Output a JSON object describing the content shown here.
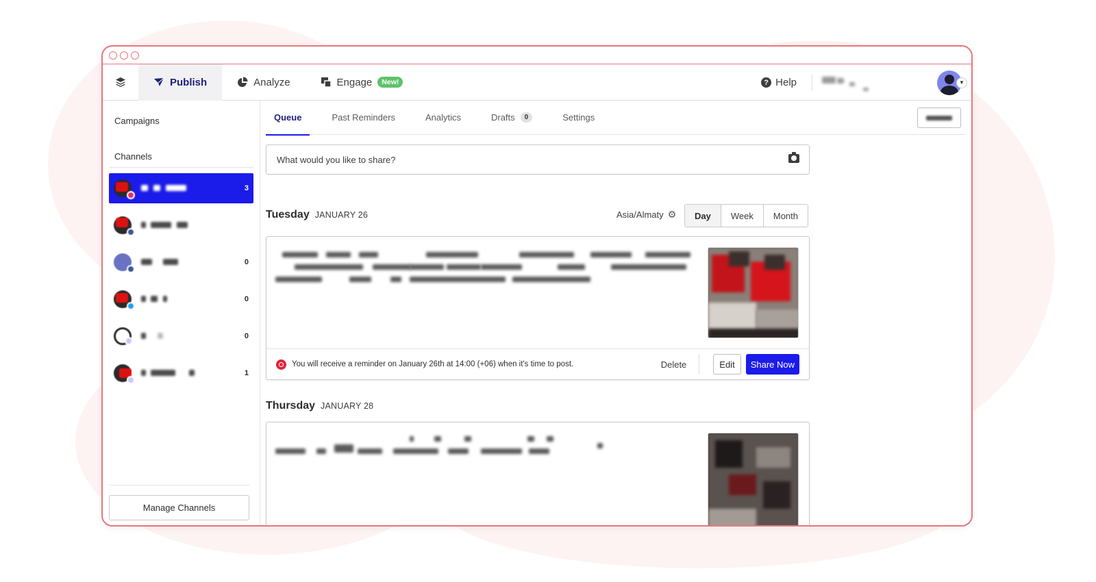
{
  "nav": {
    "publish": "Publish",
    "analyze": "Analyze",
    "engage": "Engage",
    "new_badge": "New!",
    "help": "Help"
  },
  "sidebar": {
    "campaigns": "Campaigns",
    "channels_heading": "Channels",
    "channels": [
      {
        "count": "3",
        "active": true,
        "network_color": "#e1306c"
      },
      {
        "count": "",
        "active": false,
        "network_color": "#3b5998"
      },
      {
        "count": "0",
        "active": false,
        "network_color": "#3b5998"
      },
      {
        "count": "0",
        "active": false,
        "network_color": "#1da1f2"
      },
      {
        "count": "0",
        "active": false,
        "network_color": "#1b1bea"
      },
      {
        "count": "1",
        "active": false,
        "network_color": "#c9c9ff"
      }
    ],
    "manage_channels": "Manage Channels"
  },
  "tabs": {
    "queue": "Queue",
    "past_reminders": "Past Reminders",
    "analytics": "Analytics",
    "drafts": "Drafts",
    "drafts_count": "0",
    "settings": "Settings"
  },
  "composer": {
    "placeholder": "What would you like to share?"
  },
  "timezone": "Asia/Almaty",
  "view_toggle": {
    "day": "Day",
    "week": "Week",
    "month": "Month",
    "selected": "Day"
  },
  "days": [
    {
      "name": "Tuesday",
      "date": "JANUARY 26",
      "reminder": "You will receive a reminder on January 26th at 14:00 (+06) when it's time to post.",
      "actions": {
        "delete": "Delete",
        "edit": "Edit",
        "share_now": "Share Now"
      }
    },
    {
      "name": "Thursday",
      "date": "JANUARY 28"
    }
  ],
  "colors": {
    "accent": "#1b1bea",
    "publish_nav": "#1f1f7a",
    "new_badge": "#5dc36d",
    "reminder": "#e0243a",
    "window_border": "#e8777d"
  }
}
